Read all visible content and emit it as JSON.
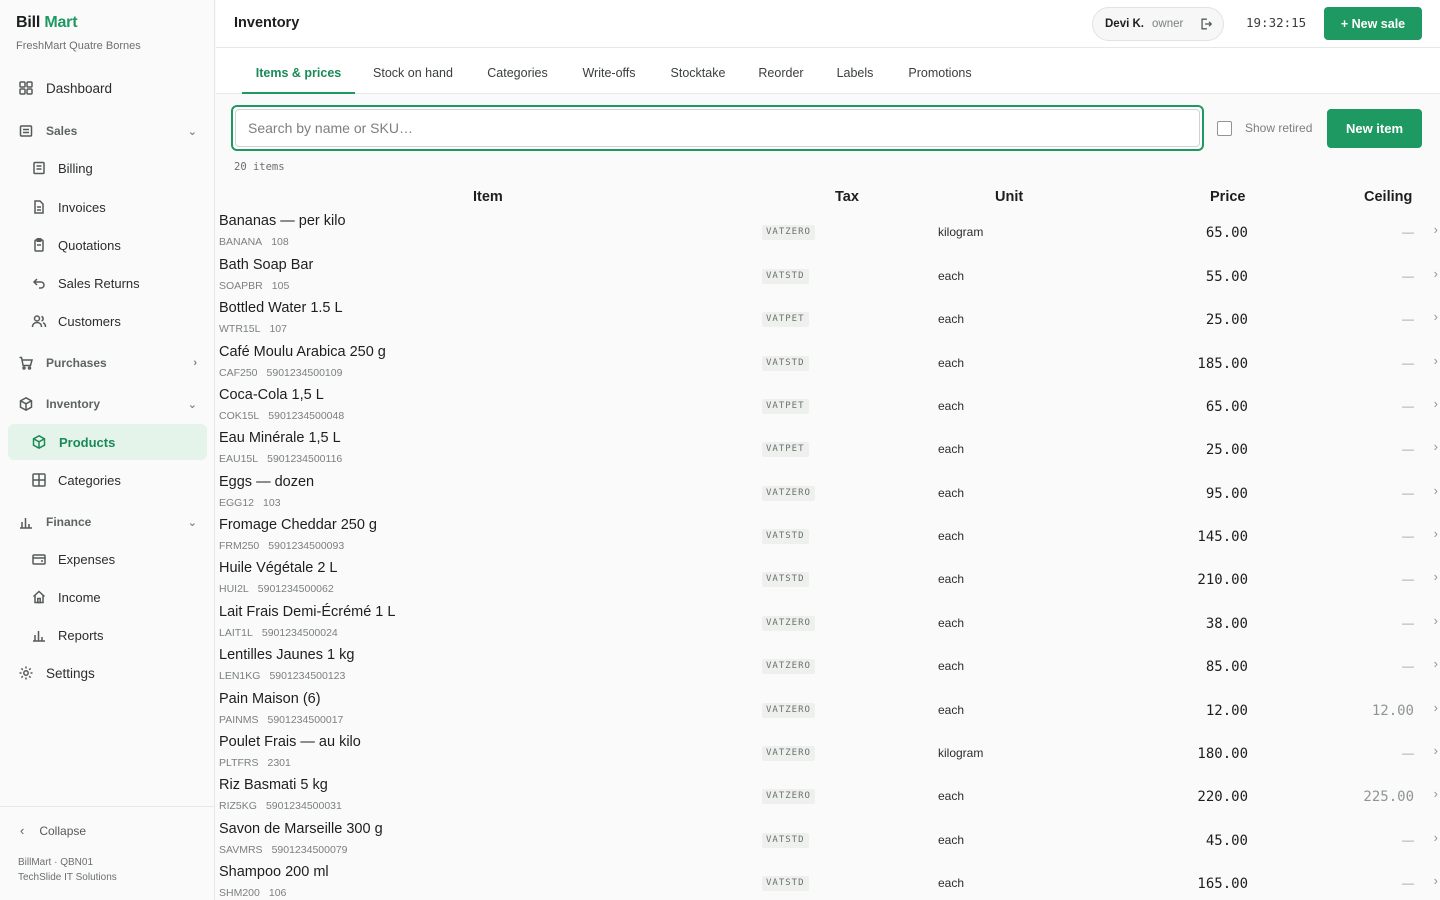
{
  "brand": {
    "name_part1": "Bill",
    "name_part2": "Mart",
    "store": "FreshMart Quatre Bornes"
  },
  "colors": {
    "accent": "#1f9962",
    "active_bg": "#e4f4ea"
  },
  "sidebar": {
    "dashboard": {
      "label": "Dashboard",
      "icon": "dashboard-icon"
    },
    "sales": {
      "label": "Sales",
      "icon": "sales-icon",
      "expanded": true
    },
    "billing": {
      "label": "Billing",
      "icon": "receipt-icon"
    },
    "invoices": {
      "label": "Invoices",
      "icon": "document-icon"
    },
    "quotations": {
      "label": "Quotations",
      "icon": "clipboard-icon"
    },
    "sales_returns": {
      "label": "Sales Returns",
      "icon": "return-icon"
    },
    "customers": {
      "label": "Customers",
      "icon": "users-icon"
    },
    "purchases": {
      "label": "Purchases",
      "icon": "cart-icon",
      "expanded": false
    },
    "inventory": {
      "label": "Inventory",
      "icon": "box-icon",
      "expanded": true
    },
    "products": {
      "label": "Products",
      "icon": "box-icon",
      "active": true
    },
    "categories": {
      "label": "Categories",
      "icon": "grid-icon"
    },
    "finance": {
      "label": "Finance",
      "icon": "bar-chart-icon",
      "expanded": true
    },
    "expenses": {
      "label": "Expenses",
      "icon": "wallet-icon"
    },
    "income": {
      "label": "Income",
      "icon": "home-icon"
    },
    "reports": {
      "label": "Reports",
      "icon": "bar-chart-icon"
    },
    "settings": {
      "label": "Settings",
      "icon": "gear-icon"
    },
    "collapse": "Collapse",
    "footer_line1": "BillMart · QBN01",
    "footer_line2": "TechSlide IT Solutions"
  },
  "header": {
    "title": "Inventory",
    "user_name": "Devi K.",
    "user_role": "owner",
    "clock": "19:32:15",
    "new_sale": "+ New sale"
  },
  "tabs": [
    {
      "label": "Items & prices",
      "active": true
    },
    {
      "label": "Stock on hand"
    },
    {
      "label": "Categories"
    },
    {
      "label": "Write-offs"
    },
    {
      "label": "Stocktake"
    },
    {
      "label": "Reorder"
    },
    {
      "label": "Labels"
    },
    {
      "label": "Promotions"
    }
  ],
  "toolbar": {
    "search_placeholder": "Search by name or SKU…",
    "search_value": "",
    "show_retired": "Show retired",
    "show_retired_checked": false,
    "new_item": "New item",
    "count": "20 items"
  },
  "table": {
    "headers": {
      "item": "Item",
      "tax": "Tax",
      "unit": "Unit",
      "price": "Price",
      "ceiling": "Ceiling"
    },
    "rows": [
      {
        "name": "Bananas — per kilo",
        "sku": "BANANA",
        "code": "108",
        "tax": "VATZERO",
        "unit": "kilogram",
        "price": "65.00",
        "ceiling": "—"
      },
      {
        "name": "Bath Soap Bar",
        "sku": "SOAPBR",
        "code": "105",
        "tax": "VATSTD",
        "unit": "each",
        "price": "55.00",
        "ceiling": "—"
      },
      {
        "name": "Bottled Water 1.5 L",
        "sku": "WTR15L",
        "code": "107",
        "tax": "VATPET",
        "unit": "each",
        "price": "25.00",
        "ceiling": "—"
      },
      {
        "name": "Café Moulu Arabica 250 g",
        "sku": "CAF250",
        "code": "5901234500109",
        "tax": "VATSTD",
        "unit": "each",
        "price": "185.00",
        "ceiling": "—"
      },
      {
        "name": "Coca-Cola 1,5 L",
        "sku": "COK15L",
        "code": "5901234500048",
        "tax": "VATPET",
        "unit": "each",
        "price": "65.00",
        "ceiling": "—"
      },
      {
        "name": "Eau Minérale 1,5 L",
        "sku": "EAU15L",
        "code": "5901234500116",
        "tax": "VATPET",
        "unit": "each",
        "price": "25.00",
        "ceiling": "—"
      },
      {
        "name": "Eggs — dozen",
        "sku": "EGG12",
        "code": "103",
        "tax": "VATZERO",
        "unit": "each",
        "price": "95.00",
        "ceiling": "—"
      },
      {
        "name": "Fromage Cheddar 250 g",
        "sku": "FRM250",
        "code": "5901234500093",
        "tax": "VATSTD",
        "unit": "each",
        "price": "145.00",
        "ceiling": "—"
      },
      {
        "name": "Huile Végétale 2 L",
        "sku": "HUI2L",
        "code": "5901234500062",
        "tax": "VATSTD",
        "unit": "each",
        "price": "210.00",
        "ceiling": "—"
      },
      {
        "name": "Lait Frais Demi-Écrémé 1 L",
        "sku": "LAIT1L",
        "code": "5901234500024",
        "tax": "VATZERO",
        "unit": "each",
        "price": "38.00",
        "ceiling": "—"
      },
      {
        "name": "Lentilles Jaunes 1 kg",
        "sku": "LEN1KG",
        "code": "5901234500123",
        "tax": "VATZERO",
        "unit": "each",
        "price": "85.00",
        "ceiling": "—"
      },
      {
        "name": "Pain Maison (6)",
        "sku": "PAINMS",
        "code": "5901234500017",
        "tax": "VATZERO",
        "unit": "each",
        "price": "12.00",
        "ceiling": "12.00"
      },
      {
        "name": "Poulet Frais — au kilo",
        "sku": "PLTFRS",
        "code": "2301",
        "tax": "VATZERO",
        "unit": "kilogram",
        "price": "180.00",
        "ceiling": "—"
      },
      {
        "name": "Riz Basmati 5 kg",
        "sku": "RIZ5KG",
        "code": "5901234500031",
        "tax": "VATZERO",
        "unit": "each",
        "price": "220.00",
        "ceiling": "225.00"
      },
      {
        "name": "Savon de Marseille 300 g",
        "sku": "SAVMRS",
        "code": "5901234500079",
        "tax": "VATSTD",
        "unit": "each",
        "price": "45.00",
        "ceiling": "—"
      },
      {
        "name": "Shampoo 200 ml",
        "sku": "SHM200",
        "code": "106",
        "tax": "VATSTD",
        "unit": "each",
        "price": "165.00",
        "ceiling": "—"
      }
    ]
  }
}
